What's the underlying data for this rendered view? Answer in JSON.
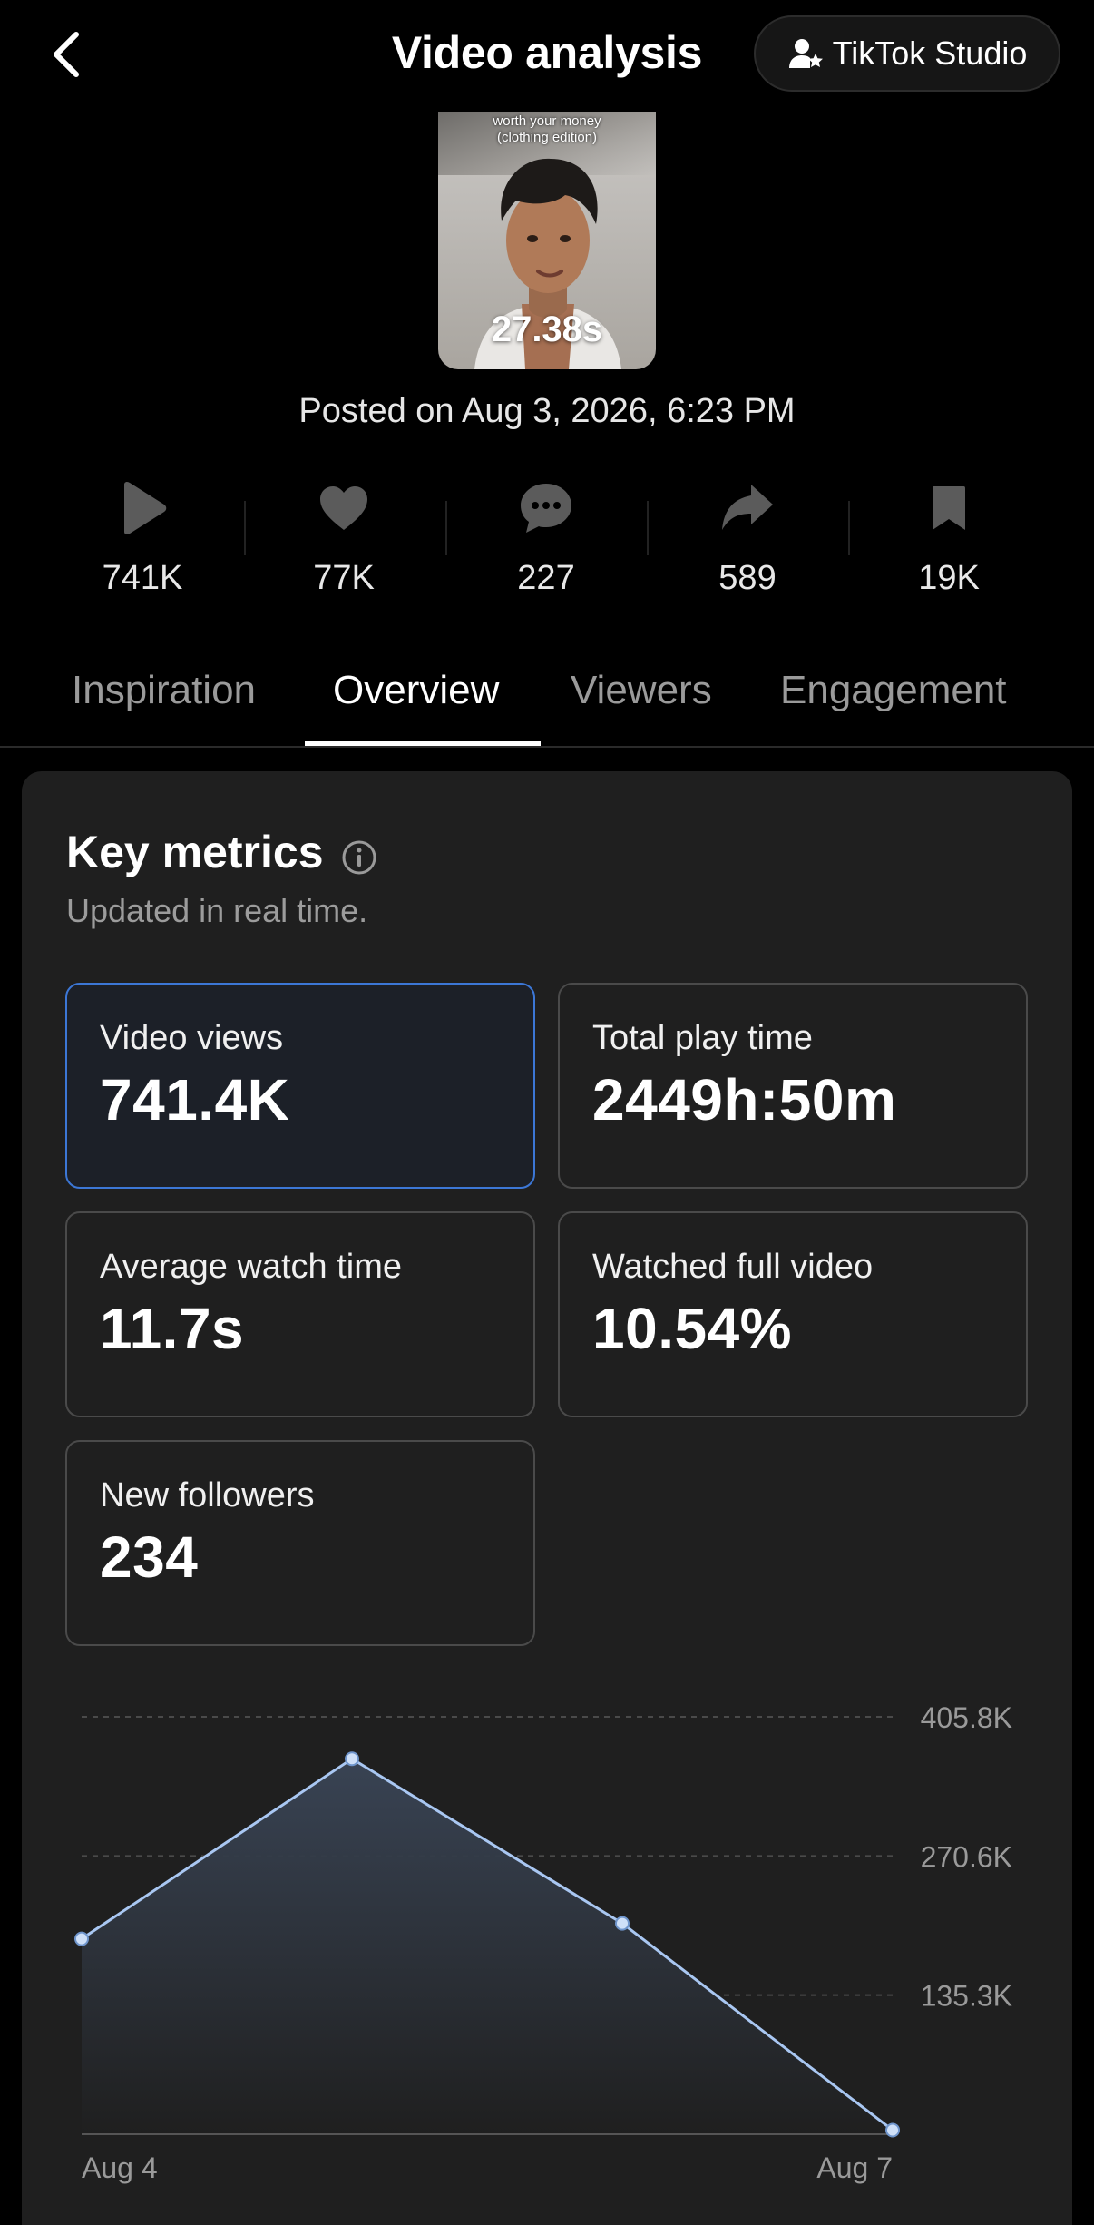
{
  "header": {
    "title": "Video analysis",
    "studio_button": "TikTok Studio"
  },
  "video": {
    "caption_line1": "worth your money",
    "caption_line2": "(clothing edition)",
    "duration": "27.38s",
    "posted": "Posted on Aug 3, 2026, 6:23 PM"
  },
  "stats": {
    "plays": "741K",
    "likes": "77K",
    "comments": "227",
    "shares": "589",
    "saves": "19K"
  },
  "tabs": [
    {
      "label": "Inspiration"
    },
    {
      "label": "Overview"
    },
    {
      "label": "Viewers"
    },
    {
      "label": "Engagement"
    }
  ],
  "active_tab": "Overview",
  "key_metrics": {
    "title": "Key metrics",
    "subtitle": "Updated in real time.",
    "items": [
      {
        "label": "Video views",
        "value": "741.4K"
      },
      {
        "label": "Total play time",
        "value": "2449h:50m"
      },
      {
        "label": "Average watch time",
        "value": "11.7s"
      },
      {
        "label": "Watched full video",
        "value": "10.54%"
      },
      {
        "label": "New followers",
        "value": "234"
      }
    ]
  },
  "colors": {
    "accent_blue": "#3c77d6",
    "line": "#a9c7f2"
  },
  "chart_data": {
    "type": "area",
    "x": [
      "Aug 4",
      "Aug 5",
      "Aug 6",
      "Aug 7"
    ],
    "values": [
      190000,
      365000,
      205000,
      4000
    ],
    "y_ticks": [
      "405.8K",
      "270.6K",
      "135.3K"
    ],
    "x_labels": [
      "Aug 4",
      "Aug 7"
    ],
    "ylim": [
      0,
      405800
    ],
    "grid": true,
    "y_axis_position": "right"
  }
}
